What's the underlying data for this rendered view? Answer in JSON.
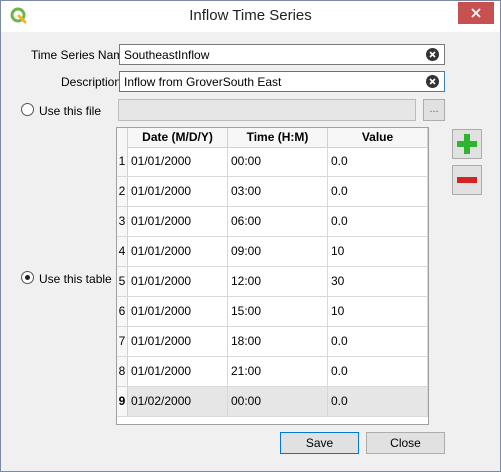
{
  "window": {
    "title": "Inflow Time Series"
  },
  "form": {
    "name_label": "Time Series Name",
    "name_value": "SoutheastInflow",
    "desc_label": "Description",
    "desc_value": "Inflow from GroverSouth East",
    "use_file_label": "Use this file",
    "browse_label": "...",
    "use_table_label": "Use this table"
  },
  "table": {
    "headers": [
      "Date (M/D/Y)",
      "Time (H:M)",
      "Value"
    ],
    "rows": [
      {
        "n": "1",
        "date": "01/01/2000",
        "time": "00:00",
        "value": "0.0"
      },
      {
        "n": "2",
        "date": "01/01/2000",
        "time": "03:00",
        "value": "0.0"
      },
      {
        "n": "3",
        "date": "01/01/2000",
        "time": "06:00",
        "value": "0.0"
      },
      {
        "n": "4",
        "date": "01/01/2000",
        "time": "09:00",
        "value": "10"
      },
      {
        "n": "5",
        "date": "01/01/2000",
        "time": "12:00",
        "value": "30"
      },
      {
        "n": "6",
        "date": "01/01/2000",
        "time": "15:00",
        "value": "10"
      },
      {
        "n": "7",
        "date": "01/01/2000",
        "time": "18:00",
        "value": "0.0"
      },
      {
        "n": "8",
        "date": "01/01/2000",
        "time": "21:00",
        "value": "0.0"
      },
      {
        "n": "9",
        "date": "01/02/2000",
        "time": "00:00",
        "value": "0.0"
      }
    ]
  },
  "buttons": {
    "save": "Save",
    "close": "Close"
  },
  "colors": {
    "add": "#2db52d",
    "remove": "#d52222",
    "accent": "#0078d7"
  }
}
